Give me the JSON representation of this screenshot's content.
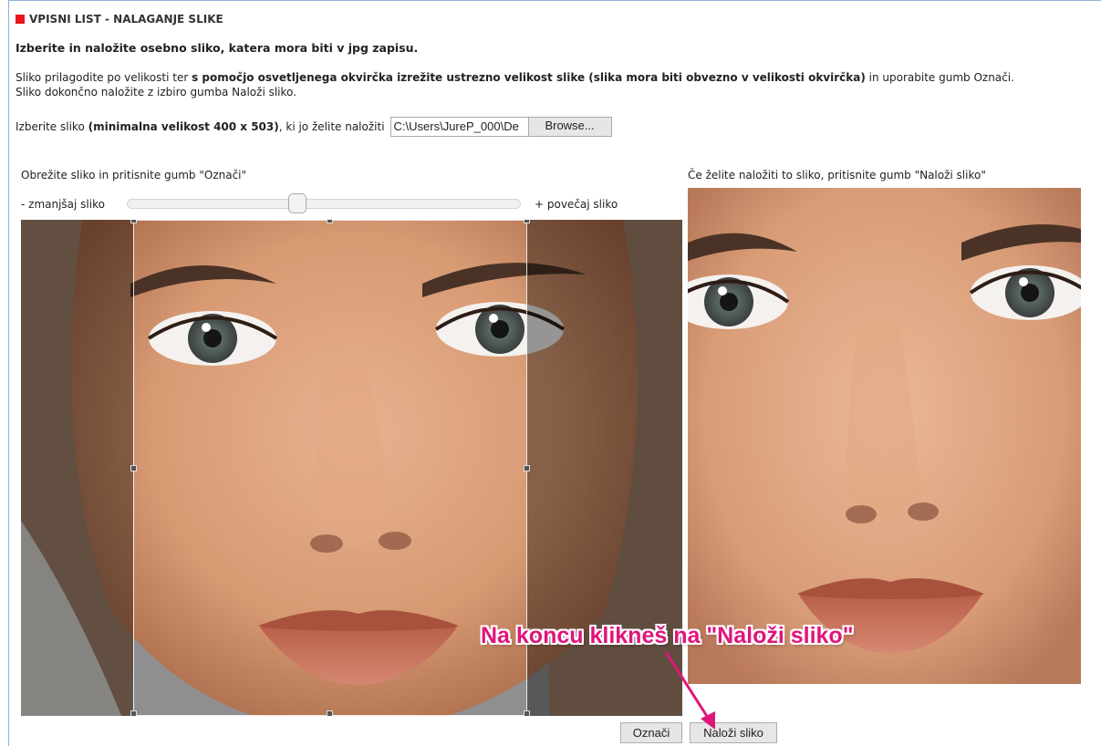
{
  "header": {
    "title": "VPISNI LIST - NALAGANJE SLIKE",
    "accent": "#e8141c"
  },
  "intro": "Izberite in naložite osebno sliko, katera mora biti v jpg zapisu.",
  "description": {
    "line1_a": "Sliko prilagodite po velikosti ter ",
    "line1_b": "s pomočjo osvetljenega okvirčka izrežite ustrezno velikost slike (slika mora biti obvezno v velikosti okvirčka)",
    "line1_c": " in uporabite gumb Označi.",
    "line2": "Sliko dokončno naložite z izbiro gumba Naloži sliko."
  },
  "file_row": {
    "label_a": "Izberite sliko ",
    "label_b": "(minimalna velikost 400 x 503)",
    "label_c": ", ki jo želite naložiti",
    "path_value": "C:\\Users\\JureP_000\\De",
    "browse_label": "Browse..."
  },
  "crop_panel": {
    "instruction": "Obrežite sliko in pritisnite gumb \"Označi\"",
    "zoom_out_label": "- zmanjšaj sliko",
    "zoom_in_label": "+ povečaj sliko",
    "zoom_level": 0.43,
    "image_icon": "face-photo"
  },
  "preview_panel": {
    "instruction": "Če želite naložiti to sliko, pritisnite gumb \"Naloži sliko\"",
    "image_icon": "face-photo-cropped"
  },
  "buttons": {
    "mark_label": "Označi",
    "upload_label": "Naloži sliko"
  },
  "annotation": {
    "text": "Na koncu klikneš na \"Naloži sliko\"",
    "color": "#e0157a"
  }
}
